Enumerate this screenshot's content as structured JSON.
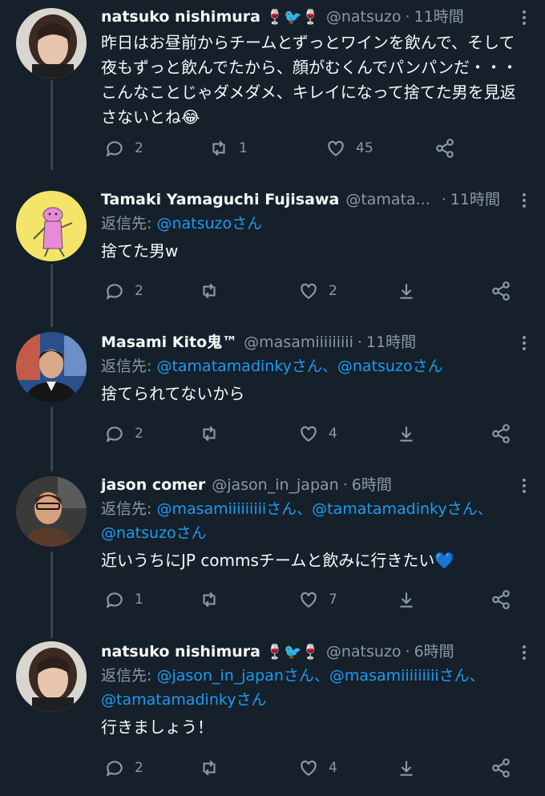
{
  "tweets": [
    {
      "name": "natsuko nishimura",
      "name_emoji": "🍷🐦🍷",
      "handle": "@natsuzo",
      "time": "11時間",
      "text": "昨日はお昼前からチームとずっとワインを飲んで、そして夜もずっと飲んでたから、顔がむくんでパンパンだ・・・こんなことじゃダメダメ、キレイになって捨てた男を見返さないとね😂",
      "replies": "2",
      "retweets": "1",
      "likes": "45"
    },
    {
      "name": "Tamaki Yamaguchi Fujisawa",
      "handle": "@tamata...",
      "time": "11時間",
      "reply_label": "返信先: ",
      "reply_targets": "@natsuzoさん",
      "text": "捨てた男w",
      "replies": "2",
      "retweets": "",
      "likes": "2"
    },
    {
      "name": "Masami Kito鬼™",
      "handle": "@masamiiiiiiiii",
      "time": "11時間",
      "reply_label": "返信先: ",
      "reply_targets": "@tamatamadinkyさん、@natsuzoさん",
      "text": "捨てられてないから",
      "replies": "2",
      "retweets": "",
      "likes": "4"
    },
    {
      "name": "jason comer",
      "handle": "@jason_in_japan",
      "time": "6時間",
      "reply_label": "返信先: ",
      "reply_targets": "@masamiiiiiiiiiさん、@tamatamadinkyさん、@natsuzoさん",
      "text": "近いうちにJP commsチームと飲みに行きたい💙",
      "replies": "1",
      "retweets": "",
      "likes": "7"
    },
    {
      "name": "natsuko nishimura",
      "name_emoji": "🍷🐦🍷",
      "handle": "@natsuzo",
      "time": "6時間",
      "reply_label": "返信先: ",
      "reply_targets": "@jason_in_japanさん、@masamiiiiiiiiiさん、@tamatamadinkyさん",
      "text": "行きましょう！",
      "replies": "2",
      "retweets": "",
      "likes": "4"
    }
  ],
  "icons": {
    "reply": "reply-icon",
    "retweet": "retweet-icon",
    "like": "heart-icon",
    "bookmark": "download-icon",
    "share": "share-icon",
    "more": "more-icon"
  },
  "colors": {
    "background": "#15202b",
    "text": "#f7f9f9",
    "muted": "#8b98a5",
    "link": "#1d9bf0",
    "thread_line": "#38444d"
  }
}
